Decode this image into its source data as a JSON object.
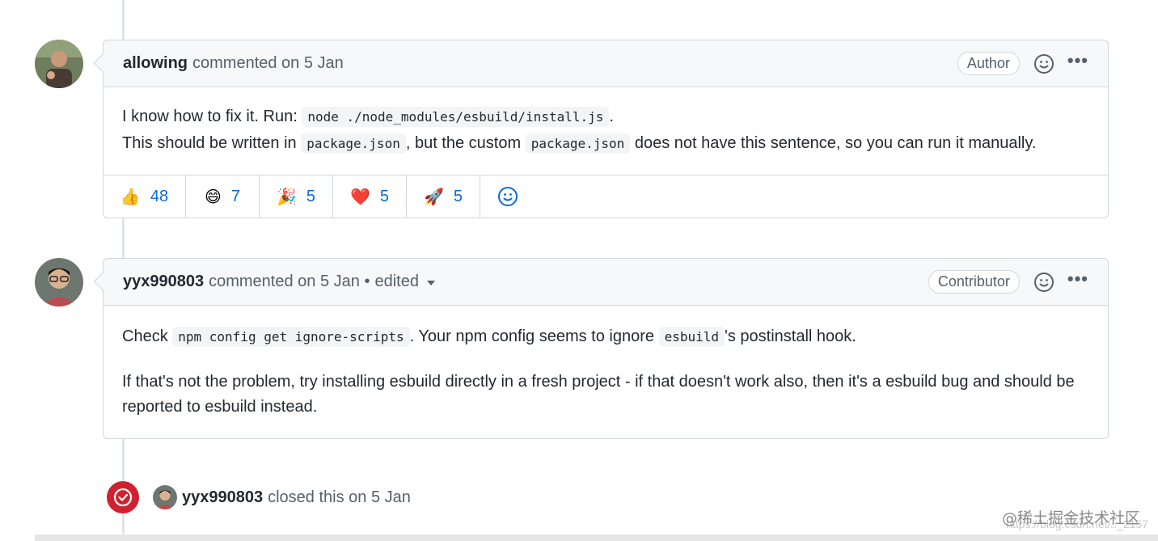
{
  "comments": [
    {
      "author": "allowing",
      "meta": "commented on 5 Jan",
      "edited": "",
      "role": "Author",
      "body": {
        "line1_prefix": "I know how to fix it. Run: ",
        "line1_code": "node ./node_modules/esbuild/install.js",
        "line1_suffix": ".",
        "line2_prefix": "This should be written in ",
        "line2_code1": "package.json",
        "line2_middle": ", but the custom ",
        "line2_code2": "package.json",
        "line2_suffix": " does not have this sentence, so you can run it manually."
      },
      "reactions": [
        {
          "emoji": "👍",
          "icon": "thumbs-up-icon",
          "count": "48"
        },
        {
          "emoji": "😄",
          "icon": "laugh-icon",
          "count": "7"
        },
        {
          "emoji": "🎉",
          "icon": "tada-icon",
          "count": "5"
        },
        {
          "emoji": "❤️",
          "icon": "heart-icon",
          "count": "5"
        },
        {
          "emoji": "🚀",
          "icon": "rocket-icon",
          "count": "5"
        }
      ]
    },
    {
      "author": "yyx990803",
      "meta": "commented on 5 Jan •",
      "edited": "edited",
      "role": "Contributor",
      "body": {
        "p1_prefix": "Check ",
        "p1_code1": "npm config get ignore-scripts",
        "p1_middle": ". Your npm config seems to ignore ",
        "p1_code2": "esbuild",
        "p1_suffix": "'s postinstall hook.",
        "p2": "If that's not the problem, try installing esbuild directly in a fresh project - if that doesn't work also, then it's a esbuild bug and should be reported to esbuild instead."
      }
    }
  ],
  "closed_event": {
    "actor": "yyx990803",
    "text": "closed this on 5 Jan"
  },
  "watermark": {
    "main": "@稀土掘金技术社区",
    "url": "https://blog.csdn.net/.._2157"
  },
  "colors": {
    "link": "#0969da",
    "closed": "#cf222e",
    "header_bg": "#f6f8fa",
    "border": "#d0d7de"
  }
}
